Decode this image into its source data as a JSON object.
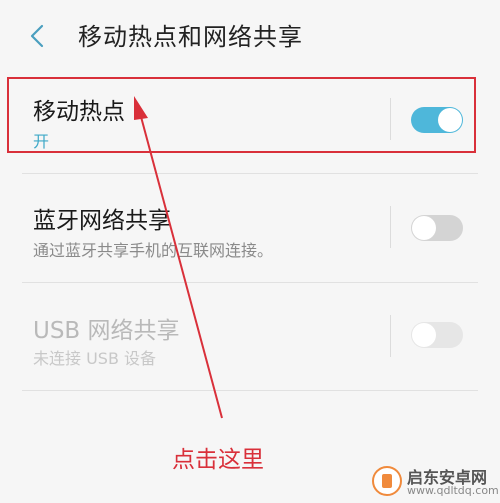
{
  "header": {
    "title": "移动热点和网络共享"
  },
  "rows": [
    {
      "title": "移动热点",
      "subtitle": "开",
      "enabled": true,
      "toggle_on": true
    },
    {
      "title": "蓝牙网络共享",
      "subtitle": "通过蓝牙共享手机的互联网连接。",
      "enabled": true,
      "toggle_on": false
    },
    {
      "title": "USB 网络共享",
      "subtitle": "未连接 USB 设备",
      "enabled": false,
      "toggle_on": false
    }
  ],
  "annotation": {
    "label": "点击这里"
  },
  "watermark": {
    "name": "启东安卓网",
    "url": "www.qdltdq.com"
  },
  "colors": {
    "toggle_on": "#4eb7da",
    "toggle_off": "#d4d4d4",
    "toggle_disabled": "#e6e6e6",
    "highlight": "#d9303a",
    "accent_text": "#3fa9c8"
  }
}
